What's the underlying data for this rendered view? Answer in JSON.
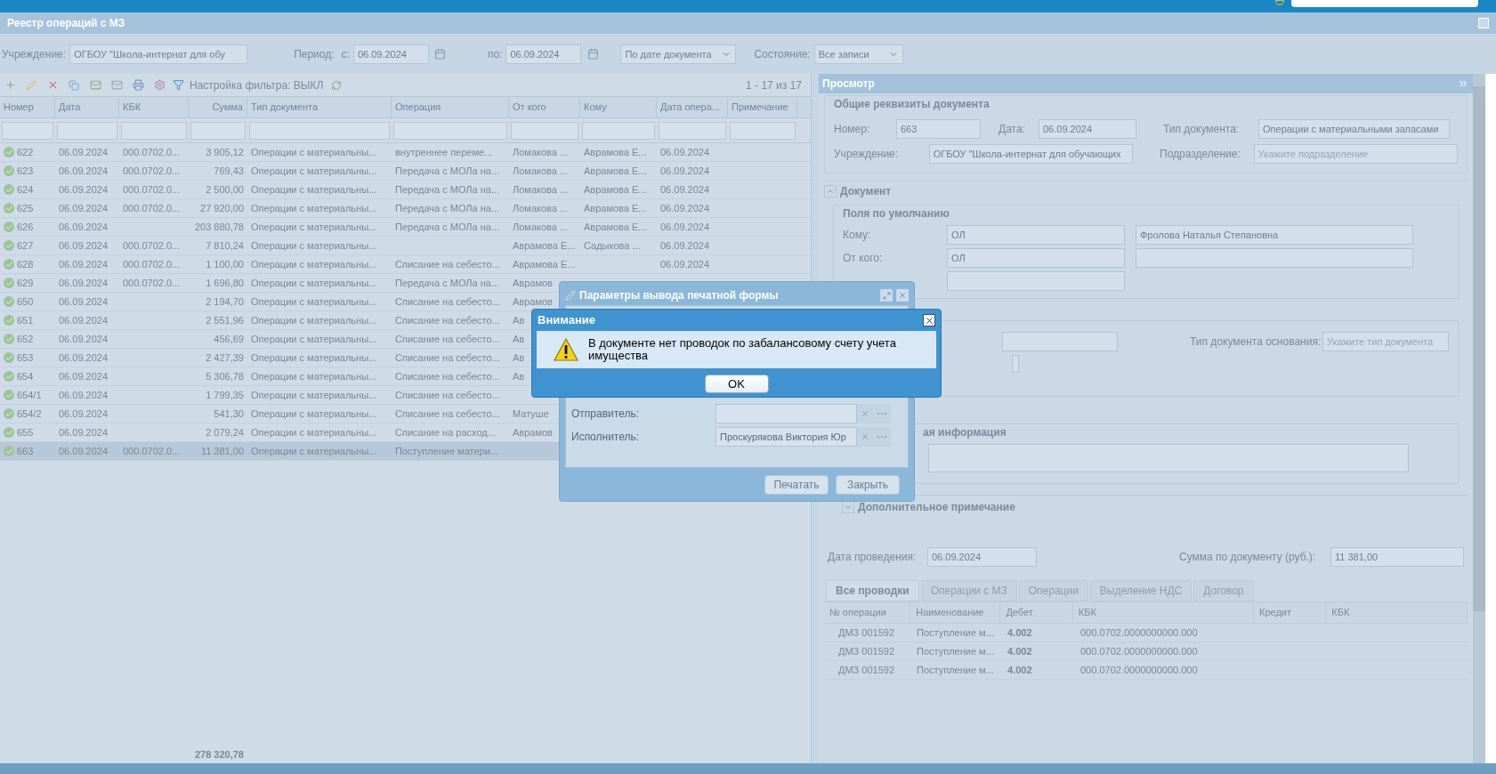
{
  "window": {
    "title": "Реестр операций с МЗ"
  },
  "filters": {
    "institution_label": "Учреждение:",
    "institution": "ОГБОУ \"Школа-интернат для обу",
    "period_label": "Период:",
    "from_label": "с:",
    "from": "06.09.2024",
    "to_label": "по:",
    "to": "06.09.2024",
    "date_mode": "По дате документа",
    "state_label": "Состояние:",
    "state": "Все записи"
  },
  "toolbar": {
    "filter_label": "Настройка фильтра: ВЫКЛ",
    "paging": "1 - 17 из 17"
  },
  "table": {
    "columns": [
      "Номер",
      "Дата",
      "КБК",
      "Сумма",
      "Тип документа",
      "Операция",
      "От кого",
      "Кому",
      "Дата опера...",
      "Примечание"
    ],
    "rows": [
      {
        "number": "622",
        "date": "06.09.2024",
        "kbk": "000.0702.0...",
        "sum": "3 905,12",
        "doc_type": "Операции с материальны...",
        "operation": "внутреннее переме...",
        "from": "Ломакова ...",
        "to": "Аврамова Е...",
        "op_date": "06.09.2024",
        "selected": false
      },
      {
        "number": "623",
        "date": "06.09.2024",
        "kbk": "000.0702.0...",
        "sum": "769,43",
        "doc_type": "Операции с материальны...",
        "operation": "Передача с МОЛа на...",
        "from": "Ломакова ...",
        "to": "Аврамова Е...",
        "op_date": "06.09.2024",
        "selected": false
      },
      {
        "number": "624",
        "date": "06.09.2024",
        "kbk": "000.0702.0...",
        "sum": "2 500,00",
        "doc_type": "Операции с материальны...",
        "operation": "Передача с МОЛа на...",
        "from": "Ломакова ...",
        "to": "Аврамова Е...",
        "op_date": "06.09.2024",
        "selected": false
      },
      {
        "number": "625",
        "date": "06.09.2024",
        "kbk": "000.0702.0...",
        "sum": "27 920,00",
        "doc_type": "Операции с материальны...",
        "operation": "Передача с МОЛа на...",
        "from": "Ломакова ...",
        "to": "Аврамова Е...",
        "op_date": "06.09.2024",
        "selected": false
      },
      {
        "number": "626",
        "date": "06.09.2024",
        "sum": "203 880,78",
        "doc_type": "Операции с материальны...",
        "operation": "Передача с МОЛа на...",
        "from": "Ломакова ...",
        "to": "Аврамова Е...",
        "op_date": "06.09.2024",
        "selected": false
      },
      {
        "number": "627",
        "date": "06.09.2024",
        "kbk": "000.0702.0...",
        "sum": "7 810,24",
        "doc_type": "Операции с материальны...",
        "from": "Аврамова Е...",
        "to": "Садыкова ...",
        "op_date": "06.09.2024",
        "selected": false
      },
      {
        "number": "628",
        "date": "06.09.2024",
        "kbk": "000.0702.0...",
        "sum": "1 100,00",
        "doc_type": "Операции с материальны...",
        "operation": "Списание на себесто...",
        "from": "Аврамова Е...",
        "op_date": "06.09.2024",
        "selected": false
      },
      {
        "number": "629",
        "date": "06.09.2024",
        "kbk": "000.0702.0...",
        "sum": "1 696,80",
        "doc_type": "Операции с материальны...",
        "operation": "Передача с МОЛа на...",
        "from": "Аврамов",
        "selected": false
      },
      {
        "number": "650",
        "date": "06.09.2024",
        "sum": "2 194,70",
        "doc_type": "Операции с материальны...",
        "operation": "Списание на себесто...",
        "from": "Аврамов",
        "selected": false
      },
      {
        "number": "651",
        "date": "06.09.2024",
        "sum": "2 551,96",
        "doc_type": "Операции с материальны...",
        "operation": "Списание на себесто...",
        "from": "Ав",
        "selected": false
      },
      {
        "number": "652",
        "date": "06.09.2024",
        "sum": "456,69",
        "doc_type": "Операции с материальны...",
        "operation": "Списание на себесто...",
        "from": "Ав",
        "selected": false
      },
      {
        "number": "653",
        "date": "06.09.2024",
        "sum": "2 427,39",
        "doc_type": "Операции с материальны...",
        "operation": "Списание на себесто...",
        "from": "Ав",
        "selected": false
      },
      {
        "number": "654",
        "date": "06.09.2024",
        "sum": "5 306,78",
        "doc_type": "Операции с материальны...",
        "operation": "Списание на себесто...",
        "from": "Ав",
        "selected": false
      },
      {
        "number": "654/1",
        "date": "06.09.2024",
        "sum": "1 799,35",
        "doc_type": "Операции с материальны...",
        "operation": "Списание на себесто...",
        "selected": false
      },
      {
        "number": "654/2",
        "date": "06.09.2024",
        "sum": "541,30",
        "doc_type": "Операции с материальны...",
        "operation": "Списание на себесто...",
        "from": "Матуше",
        "selected": false
      },
      {
        "number": "655",
        "date": "06.09.2024",
        "sum": "2 079,24",
        "doc_type": "Операции с материальны...",
        "operation": "Списание на расход...",
        "from": "Аврамов",
        "selected": false
      },
      {
        "number": "663",
        "date": "06.09.2024",
        "kbk": "000.0702.0...",
        "sum": "11 381,00",
        "doc_type": "Операции с материальны...",
        "operation": "Поступление матери...",
        "selected": true
      }
    ],
    "total": "278 320,78"
  },
  "preview": {
    "title": "Просмотр",
    "general": {
      "legend": "Общие реквизиты документа",
      "number": {
        "label": "Номер:",
        "value": "663"
      },
      "date": {
        "label": "Дата:",
        "value": "06.09.2024"
      },
      "doc_type": {
        "label": "Тип документа:",
        "value": "Операции с материальными запасами"
      },
      "institution": {
        "label": "Учреждение:",
        "value": "ОГБОУ \"Школа-интернат для обучающих"
      },
      "division": {
        "label": "Подразделение:",
        "placeholder": "Укажите подразделение"
      }
    },
    "document": {
      "title": "Документ",
      "expanded": true,
      "defaults_legend": "Поля по умолчанию",
      "rows": [
        {
          "label": "Кому:",
          "code": "ОЛ",
          "name": "Фролова Наталья Степановна"
        },
        {
          "label": "От кого:",
          "code": "ОЛ"
        }
      ],
      "basis_type_label": "Тип документа основания:",
      "basis_type_placeholder": "Укажите тип документа",
      "extra_legend": "ая информация"
    },
    "note": {
      "title": "Дополнительное примечание",
      "expanded": false
    },
    "posting_date": {
      "label": "Дата проведения:",
      "value": "06.09.2024"
    },
    "doc_sum": {
      "label": "Сумма по документу (руб.):",
      "value": "11 381,00"
    },
    "tabs": [
      {
        "label": "Все проводки",
        "selected": true
      },
      {
        "label": "Операции с МЗ",
        "selected": false
      },
      {
        "label": "Операции",
        "selected": false
      },
      {
        "label": "Выделение НДС",
        "selected": false
      },
      {
        "label": "Договор",
        "selected": false
      }
    ],
    "entries": {
      "columns": [
        "№ операции",
        "Наименование",
        "Дебет",
        "КБК",
        "Кредит",
        "КБК"
      ],
      "rows": [
        {
          "number": "ДМЗ 001592",
          "name": "Поступление м...",
          "debit": "4.002",
          "debit_kbk": "000.0702.0000000000.000"
        },
        {
          "number": "ДМЗ 001592",
          "name": "Поступление м...",
          "debit": "4.002",
          "debit_kbk": "000.0702.0000000000.000"
        },
        {
          "number": "ДМЗ 001592",
          "name": "Поступление м...",
          "debit": "4.002",
          "debit_kbk": "000.0702.0000000000.000"
        }
      ]
    }
  },
  "print_dialog": {
    "title": "Параметры вывода печатной формы",
    "fields": [
      {
        "label": "Отправитель:"
      },
      {
        "label": "Исполнитель:",
        "value": "Проскурякова Виктория Юр"
      }
    ],
    "buttons": [
      "Печатать",
      "Закрыть"
    ]
  },
  "alert": {
    "title": "Внимание",
    "message": "В документе нет проводок по забалансовому счету учета имущества",
    "button": "OK"
  }
}
